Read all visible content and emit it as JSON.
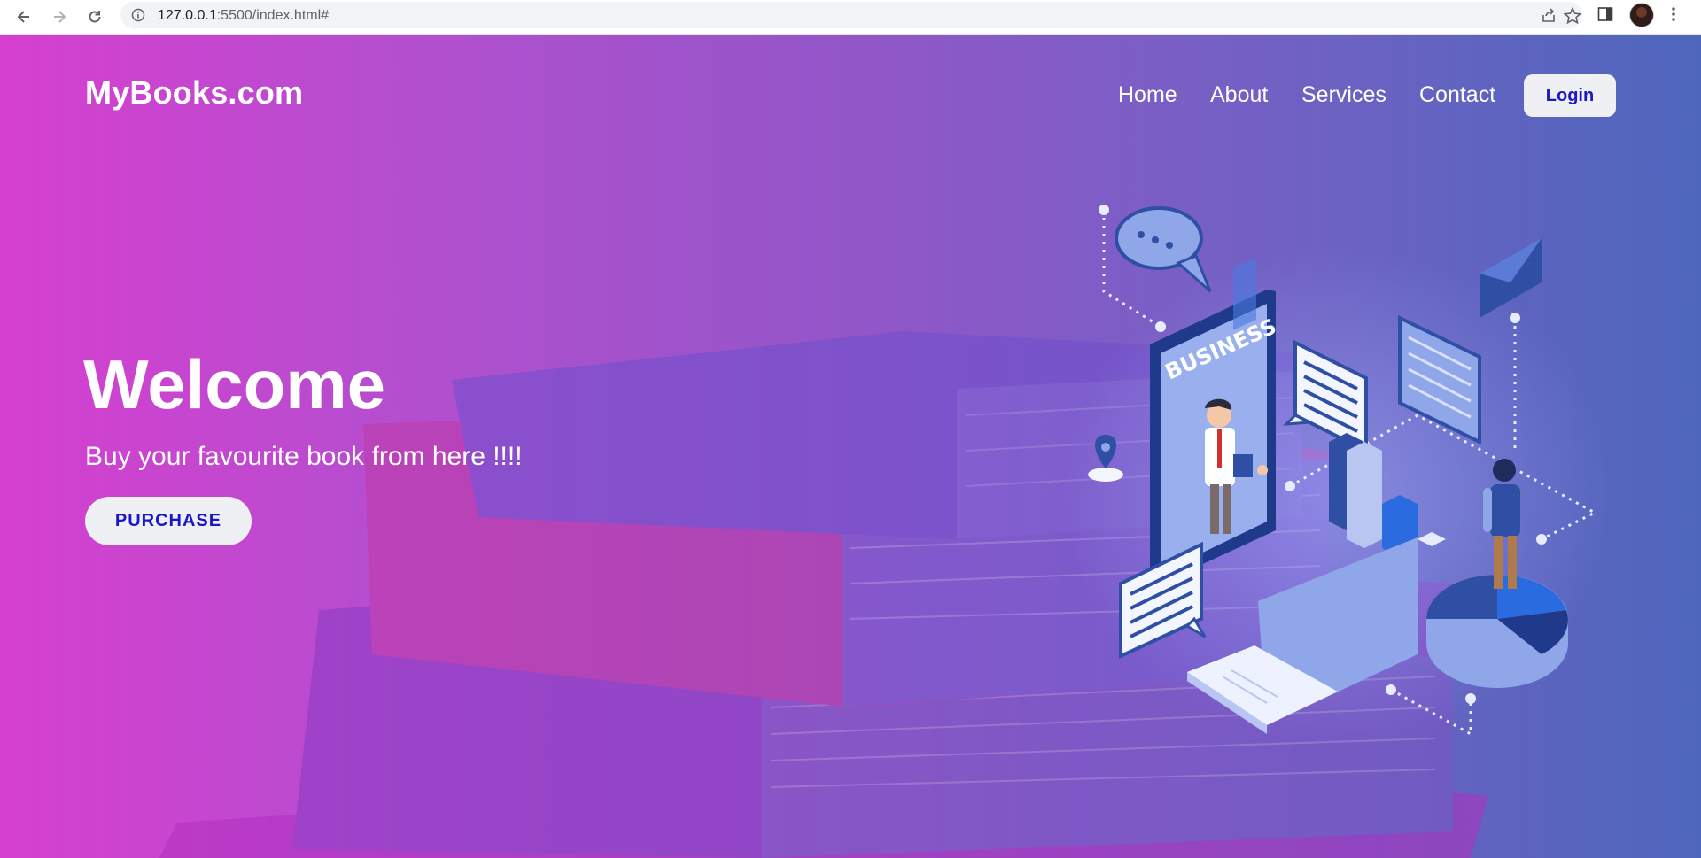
{
  "browser": {
    "url_host": "127.0.0.1",
    "url_rest": ":5500/index.html#",
    "icons": [
      "back-arrow-icon",
      "forward-arrow-icon",
      "reload-icon",
      "info-icon",
      "share-icon",
      "star-icon",
      "side-panel-icon",
      "profile-avatar",
      "kebab-menu-icon"
    ]
  },
  "site": {
    "logo": "MyBooks.com",
    "nav": {
      "home": "Home",
      "about": "About",
      "services": "Services",
      "contact": "Contact",
      "login": "Login"
    }
  },
  "hero": {
    "title": "Welcome",
    "subtitle": "Buy your favourite book from here !!!!",
    "cta": "PURCHASE",
    "illustration_label": "BUSINESS"
  },
  "colors": {
    "gradient_start": "#d63fd0",
    "gradient_end": "#4e67bd",
    "button_text": "#1b16c9",
    "button_bg": "#eef0f3"
  }
}
